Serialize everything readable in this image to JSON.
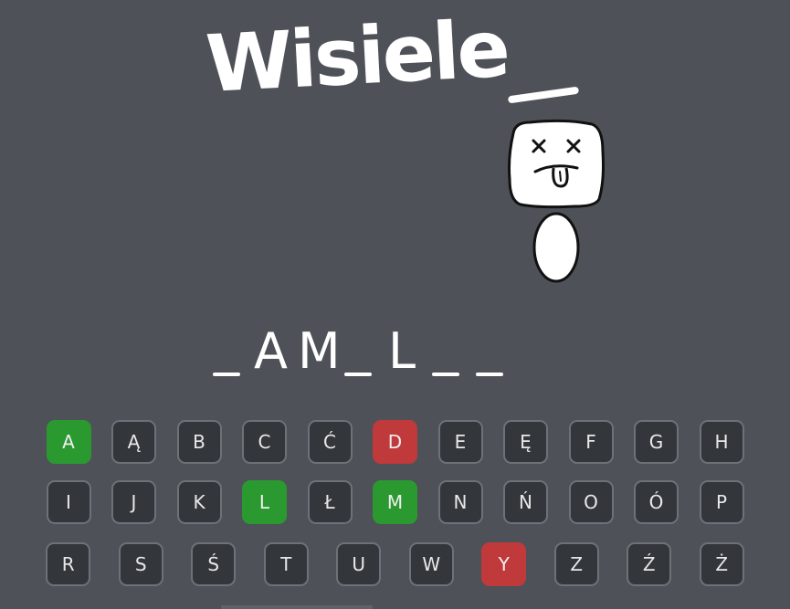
{
  "game": {
    "title": "Wisiele",
    "word_slots": [
      "",
      "A",
      "M",
      "",
      "L",
      "",
      ""
    ],
    "wrong_guesses": 2
  },
  "keyboard": {
    "rows": [
      [
        {
          "letter": "A",
          "state": "correct"
        },
        {
          "letter": "Ą",
          "state": "unused"
        },
        {
          "letter": "B",
          "state": "unused"
        },
        {
          "letter": "C",
          "state": "unused"
        },
        {
          "letter": "Ć",
          "state": "unused"
        },
        {
          "letter": "D",
          "state": "wrong"
        },
        {
          "letter": "E",
          "state": "unused"
        },
        {
          "letter": "Ę",
          "state": "unused"
        },
        {
          "letter": "F",
          "state": "unused"
        },
        {
          "letter": "G",
          "state": "unused"
        },
        {
          "letter": "H",
          "state": "unused"
        }
      ],
      [
        {
          "letter": "I",
          "state": "unused"
        },
        {
          "letter": "J",
          "state": "unused"
        },
        {
          "letter": "K",
          "state": "unused"
        },
        {
          "letter": "L",
          "state": "correct"
        },
        {
          "letter": "Ł",
          "state": "unused"
        },
        {
          "letter": "M",
          "state": "correct"
        },
        {
          "letter": "N",
          "state": "unused"
        },
        {
          "letter": "Ń",
          "state": "unused"
        },
        {
          "letter": "O",
          "state": "unused"
        },
        {
          "letter": "Ó",
          "state": "unused"
        },
        {
          "letter": "P",
          "state": "unused"
        }
      ],
      [
        {
          "letter": "R",
          "state": "unused"
        },
        {
          "letter": "S",
          "state": "unused"
        },
        {
          "letter": "Ś",
          "state": "unused"
        },
        {
          "letter": "T",
          "state": "unused"
        },
        {
          "letter": "U",
          "state": "unused"
        },
        {
          "letter": "W",
          "state": "unused"
        },
        {
          "letter": "Y",
          "state": "wrong"
        },
        {
          "letter": "Z",
          "state": "unused"
        },
        {
          "letter": "Ź",
          "state": "unused"
        },
        {
          "letter": "Ż",
          "state": "unused"
        }
      ]
    ]
  },
  "colors": {
    "background": "#4e5157",
    "key": "#33363b",
    "correct": "#2a9930",
    "wrong": "#c0393b",
    "ink": "#ffffff"
  },
  "icons": {
    "hangman": "hangman-dead-face-icon"
  }
}
